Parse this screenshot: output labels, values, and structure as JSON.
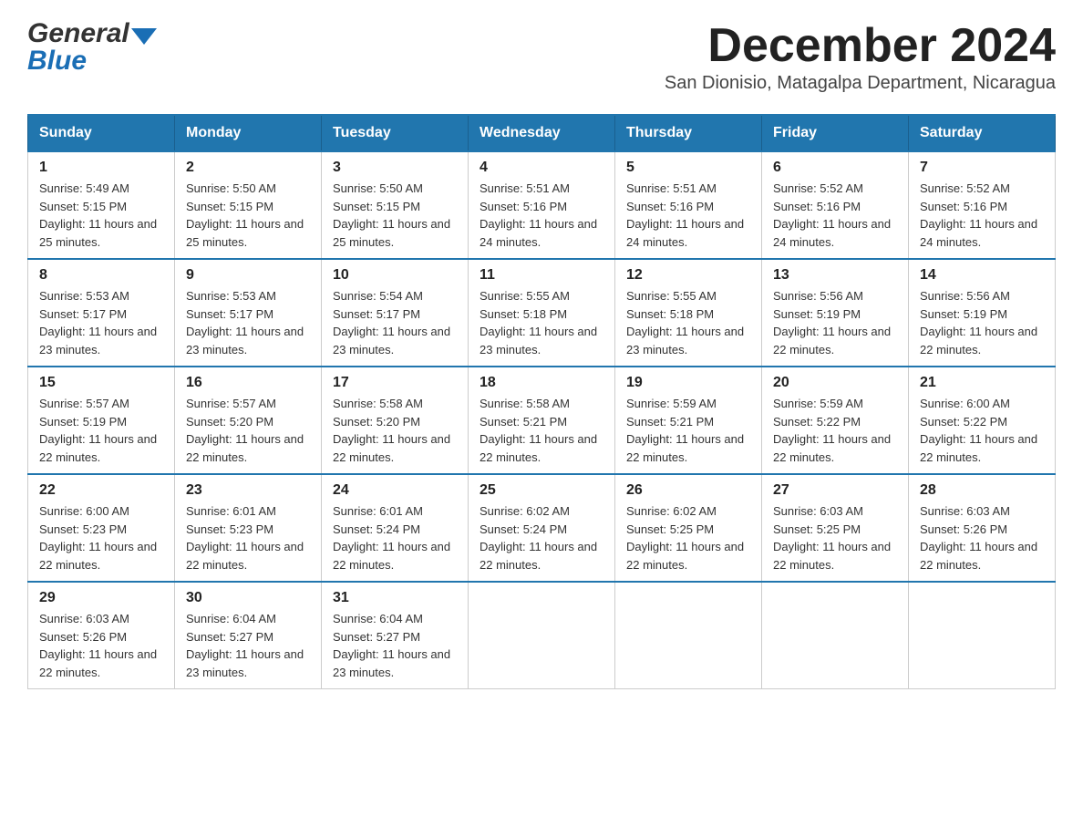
{
  "header": {
    "month_title": "December 2024",
    "subtitle": "San Dionisio, Matagalpa Department, Nicaragua",
    "logo_general": "General",
    "logo_blue": "Blue"
  },
  "columns": [
    "Sunday",
    "Monday",
    "Tuesday",
    "Wednesday",
    "Thursday",
    "Friday",
    "Saturday"
  ],
  "weeks": [
    [
      {
        "day": "1",
        "sunrise": "5:49 AM",
        "sunset": "5:15 PM",
        "daylight": "11 hours and 25 minutes."
      },
      {
        "day": "2",
        "sunrise": "5:50 AM",
        "sunset": "5:15 PM",
        "daylight": "11 hours and 25 minutes."
      },
      {
        "day": "3",
        "sunrise": "5:50 AM",
        "sunset": "5:15 PM",
        "daylight": "11 hours and 25 minutes."
      },
      {
        "day": "4",
        "sunrise": "5:51 AM",
        "sunset": "5:16 PM",
        "daylight": "11 hours and 24 minutes."
      },
      {
        "day": "5",
        "sunrise": "5:51 AM",
        "sunset": "5:16 PM",
        "daylight": "11 hours and 24 minutes."
      },
      {
        "day": "6",
        "sunrise": "5:52 AM",
        "sunset": "5:16 PM",
        "daylight": "11 hours and 24 minutes."
      },
      {
        "day": "7",
        "sunrise": "5:52 AM",
        "sunset": "5:16 PM",
        "daylight": "11 hours and 24 minutes."
      }
    ],
    [
      {
        "day": "8",
        "sunrise": "5:53 AM",
        "sunset": "5:17 PM",
        "daylight": "11 hours and 23 minutes."
      },
      {
        "day": "9",
        "sunrise": "5:53 AM",
        "sunset": "5:17 PM",
        "daylight": "11 hours and 23 minutes."
      },
      {
        "day": "10",
        "sunrise": "5:54 AM",
        "sunset": "5:17 PM",
        "daylight": "11 hours and 23 minutes."
      },
      {
        "day": "11",
        "sunrise": "5:55 AM",
        "sunset": "5:18 PM",
        "daylight": "11 hours and 23 minutes."
      },
      {
        "day": "12",
        "sunrise": "5:55 AM",
        "sunset": "5:18 PM",
        "daylight": "11 hours and 23 minutes."
      },
      {
        "day": "13",
        "sunrise": "5:56 AM",
        "sunset": "5:19 PM",
        "daylight": "11 hours and 22 minutes."
      },
      {
        "day": "14",
        "sunrise": "5:56 AM",
        "sunset": "5:19 PM",
        "daylight": "11 hours and 22 minutes."
      }
    ],
    [
      {
        "day": "15",
        "sunrise": "5:57 AM",
        "sunset": "5:19 PM",
        "daylight": "11 hours and 22 minutes."
      },
      {
        "day": "16",
        "sunrise": "5:57 AM",
        "sunset": "5:20 PM",
        "daylight": "11 hours and 22 minutes."
      },
      {
        "day": "17",
        "sunrise": "5:58 AM",
        "sunset": "5:20 PM",
        "daylight": "11 hours and 22 minutes."
      },
      {
        "day": "18",
        "sunrise": "5:58 AM",
        "sunset": "5:21 PM",
        "daylight": "11 hours and 22 minutes."
      },
      {
        "day": "19",
        "sunrise": "5:59 AM",
        "sunset": "5:21 PM",
        "daylight": "11 hours and 22 minutes."
      },
      {
        "day": "20",
        "sunrise": "5:59 AM",
        "sunset": "5:22 PM",
        "daylight": "11 hours and 22 minutes."
      },
      {
        "day": "21",
        "sunrise": "6:00 AM",
        "sunset": "5:22 PM",
        "daylight": "11 hours and 22 minutes."
      }
    ],
    [
      {
        "day": "22",
        "sunrise": "6:00 AM",
        "sunset": "5:23 PM",
        "daylight": "11 hours and 22 minutes."
      },
      {
        "day": "23",
        "sunrise": "6:01 AM",
        "sunset": "5:23 PM",
        "daylight": "11 hours and 22 minutes."
      },
      {
        "day": "24",
        "sunrise": "6:01 AM",
        "sunset": "5:24 PM",
        "daylight": "11 hours and 22 minutes."
      },
      {
        "day": "25",
        "sunrise": "6:02 AM",
        "sunset": "5:24 PM",
        "daylight": "11 hours and 22 minutes."
      },
      {
        "day": "26",
        "sunrise": "6:02 AM",
        "sunset": "5:25 PM",
        "daylight": "11 hours and 22 minutes."
      },
      {
        "day": "27",
        "sunrise": "6:03 AM",
        "sunset": "5:25 PM",
        "daylight": "11 hours and 22 minutes."
      },
      {
        "day": "28",
        "sunrise": "6:03 AM",
        "sunset": "5:26 PM",
        "daylight": "11 hours and 22 minutes."
      }
    ],
    [
      {
        "day": "29",
        "sunrise": "6:03 AM",
        "sunset": "5:26 PM",
        "daylight": "11 hours and 22 minutes."
      },
      {
        "day": "30",
        "sunrise": "6:04 AM",
        "sunset": "5:27 PM",
        "daylight": "11 hours and 23 minutes."
      },
      {
        "day": "31",
        "sunrise": "6:04 AM",
        "sunset": "5:27 PM",
        "daylight": "11 hours and 23 minutes."
      },
      null,
      null,
      null,
      null
    ]
  ]
}
